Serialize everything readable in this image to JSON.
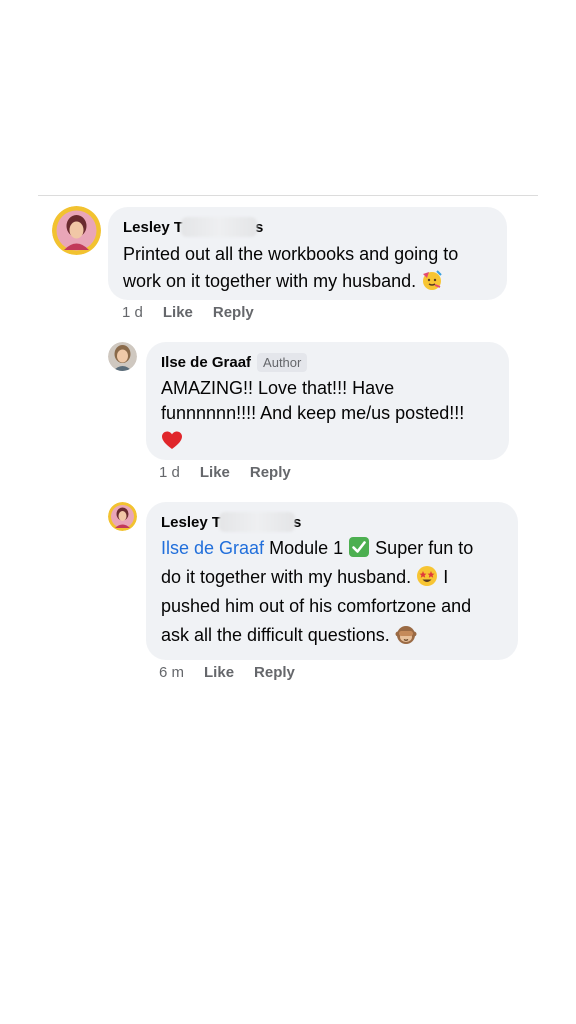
{
  "thread": {
    "comments": [
      {
        "author": "Lesley T",
        "author_suffix": "s",
        "line1": "Printed out all the workbooks and going to",
        "line2": "work on it together with my husband.",
        "emoji": "partying-face-icon",
        "time": "1 d",
        "like": "Like",
        "reply": "Reply"
      },
      {
        "author": "Ilse de Graaf",
        "badge": "Author",
        "line1": "AMAZING!! Love that!!! Have",
        "line2": "funnnnnn!!!! And keep me/us posted!!!",
        "emoji": "red-heart-icon",
        "time": "1 d",
        "like": "Like",
        "reply": "Reply"
      },
      {
        "author": "Lesley T",
        "author_suffix": "s",
        "mention": "Ilse de Graaf",
        "line1_after_mention": "Module 1",
        "line1_tail": "Super fun to",
        "line2": "do it together with my husband.",
        "line2_tail": "I",
        "line3": "pushed him out of his comfortzone and",
        "line4": "ask all the difficult questions.",
        "emojis": [
          "check-mark-button-icon",
          "star-struck-face-icon",
          "see-no-evil-monkey-icon"
        ],
        "time": "6 m",
        "like": "Like",
        "reply": "Reply"
      }
    ]
  }
}
